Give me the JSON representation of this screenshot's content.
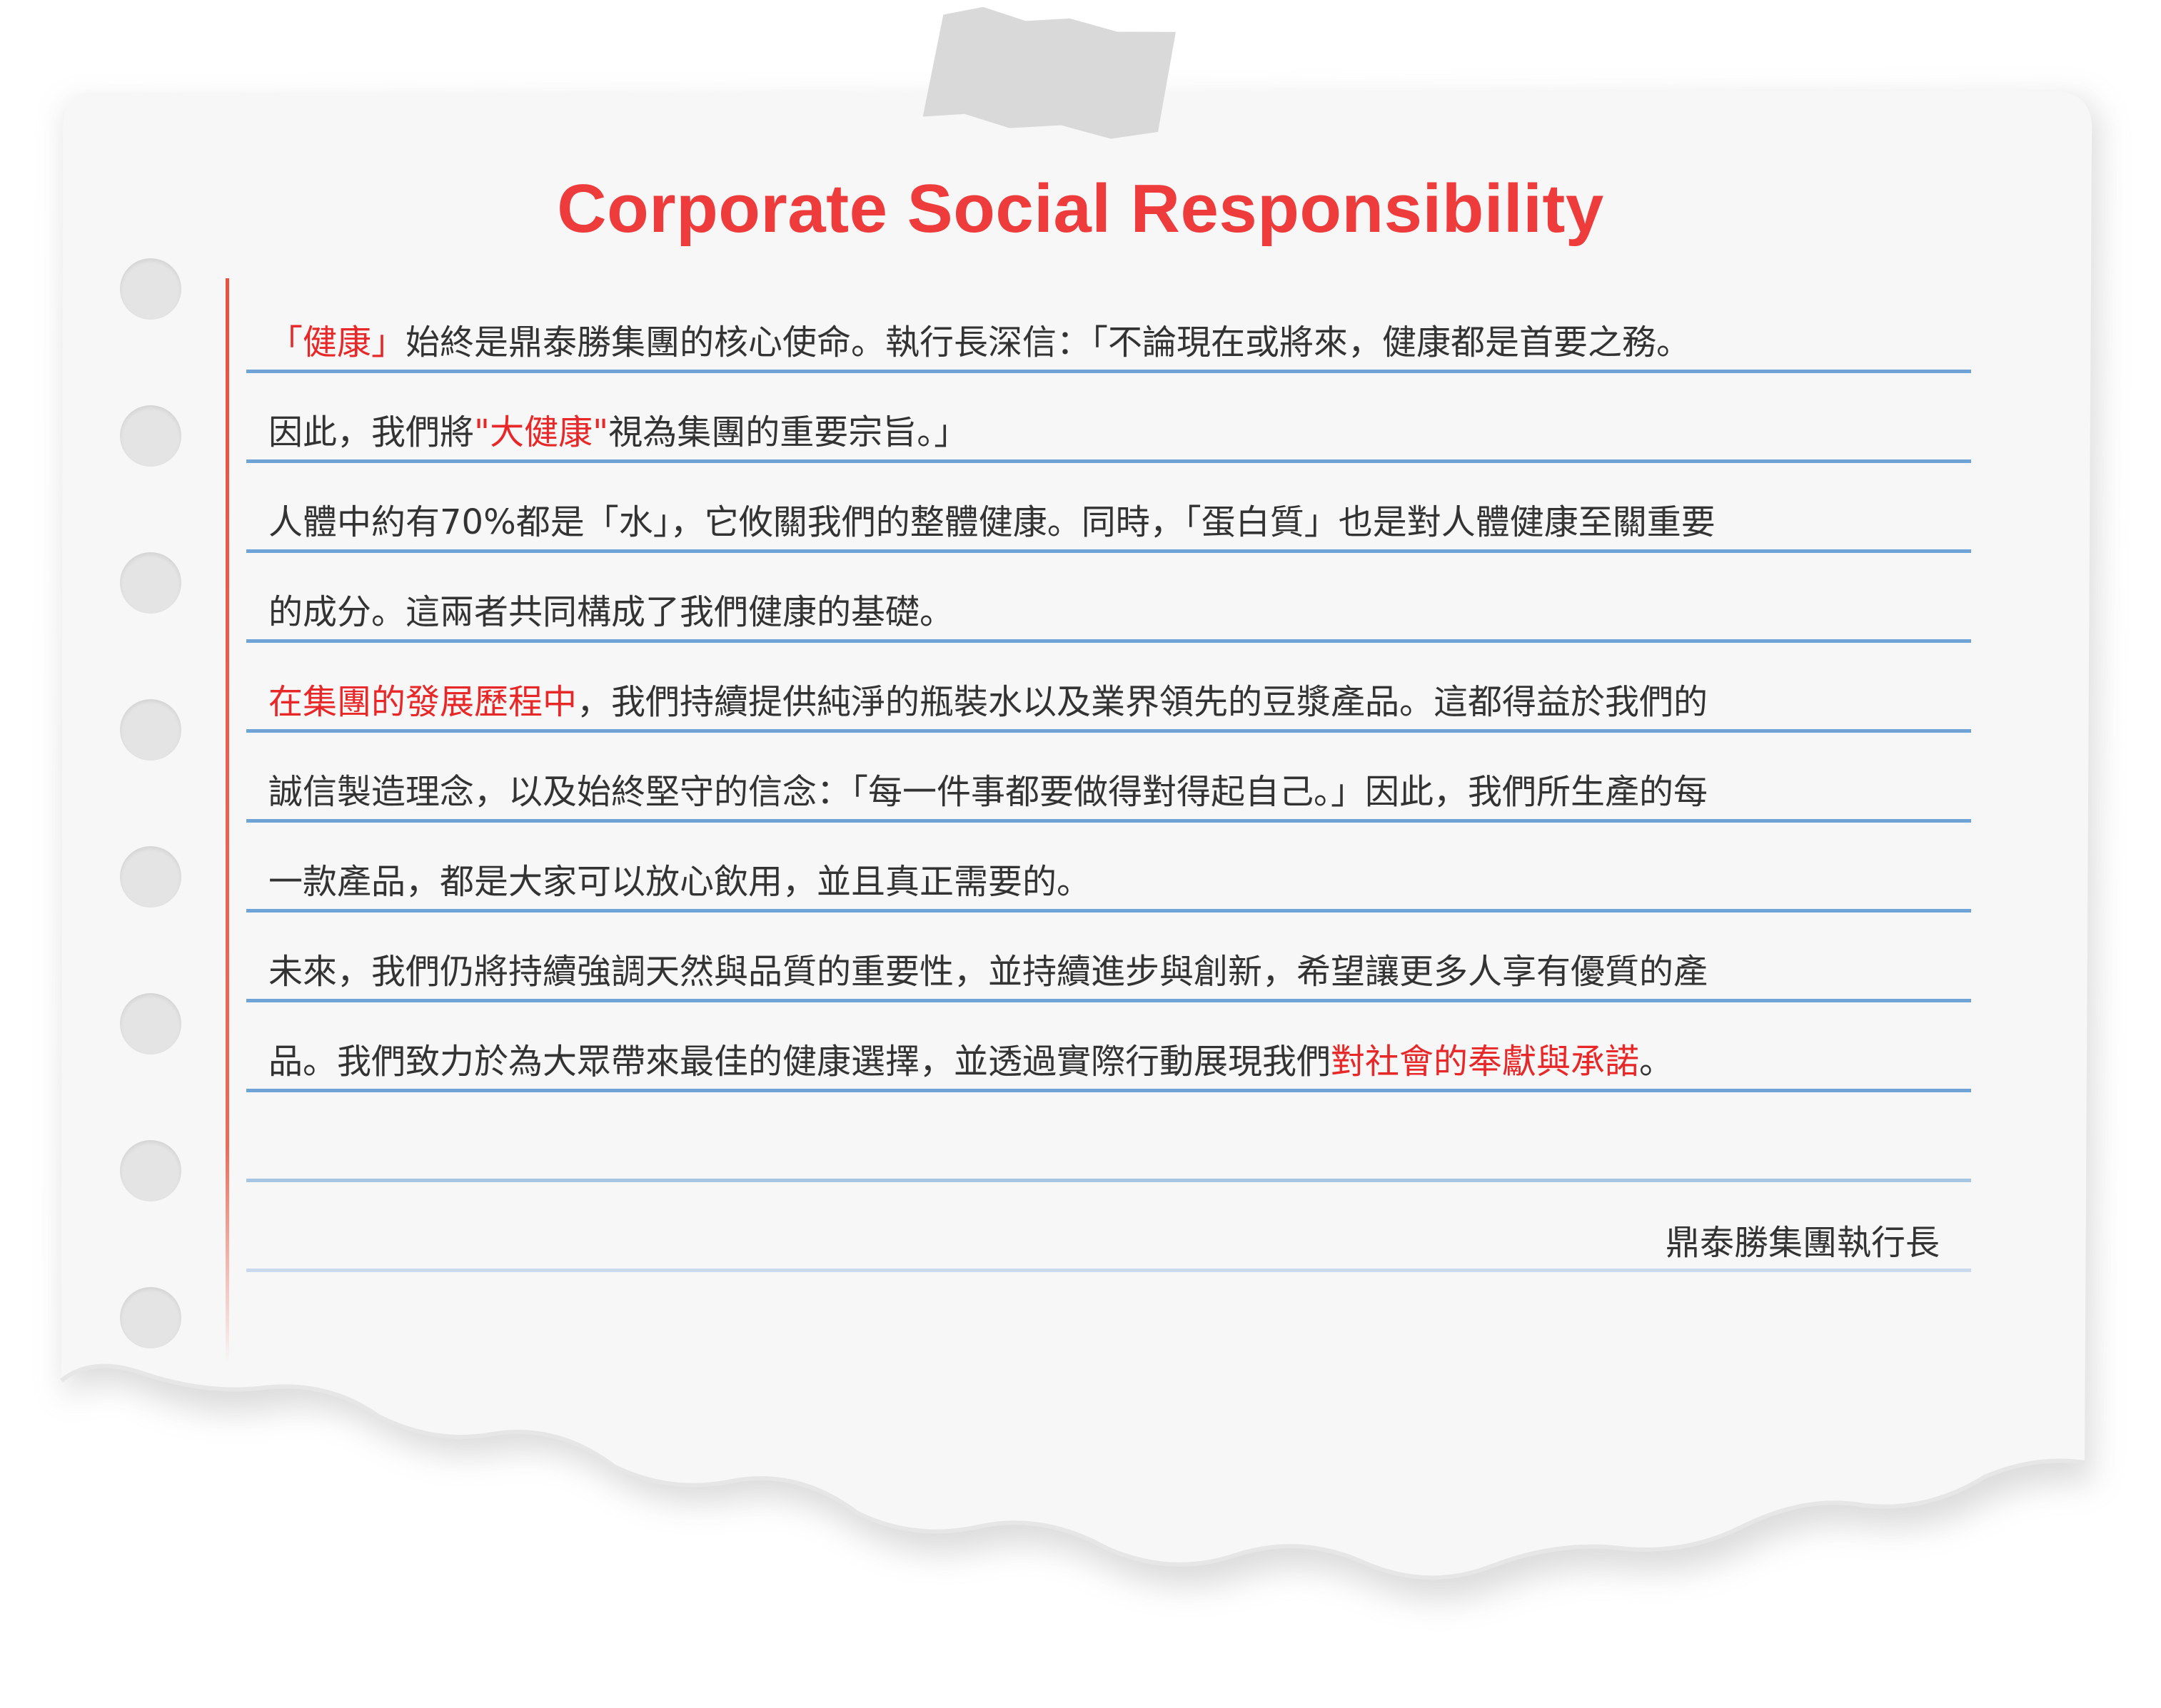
{
  "title": "Corporate Social Responsibility",
  "lines": [
    [
      {
        "t": "「健康」",
        "h": true
      },
      {
        "t": "始終是鼎泰勝集團的核心使命。執行長深信：「不論現在或將來，健康都是首要之務。",
        "h": false
      }
    ],
    [
      {
        "t": "因此，我們將",
        "h": false
      },
      {
        "t": "\"大健康\"",
        "h": true
      },
      {
        "t": "視為集團的重要宗旨。」",
        "h": false
      }
    ],
    [
      {
        "t": "人體中約有70%都是「水」，它攸關我們的整體健康。同時，「蛋白質」也是對人體健康至關重要",
        "h": false
      }
    ],
    [
      {
        "t": "的成分。這兩者共同構成了我們健康的基礎。",
        "h": false
      }
    ],
    [
      {
        "t": "在集團的發展歷程中",
        "h": true
      },
      {
        "t": "，我們持續提供純淨的瓶裝水以及業界領先的豆漿產品。這都得益於我們的",
        "h": false
      }
    ],
    [
      {
        "t": "誠信製造理念，以及始終堅守的信念：「每一件事都要做得對得起自己。」因此，我們所生產的每",
        "h": false
      }
    ],
    [
      {
        "t": "一款產品，都是大家可以放心飲用，並且真正需要的。",
        "h": false
      }
    ],
    [
      {
        "t": "未來，我們仍將持續強調天然與品質的重要性，並持續進步與創新，希望讓更多人享有優質的產",
        "h": false
      }
    ],
    [
      {
        "t": "品。我們致力於為大眾帶來最佳的健康選擇，並透過實際行動展現我們",
        "h": false
      },
      {
        "t": "對社會的奉獻與承諾",
        "h": true
      },
      {
        "t": "。",
        "h": false
      }
    ]
  ],
  "signature": "鼎泰勝集團執行長",
  "colors": {
    "accent": "#ee3b3b",
    "highlight": "#e82828",
    "rule": "#6fa3d6",
    "margin": "#e8523f",
    "text": "#333333"
  }
}
